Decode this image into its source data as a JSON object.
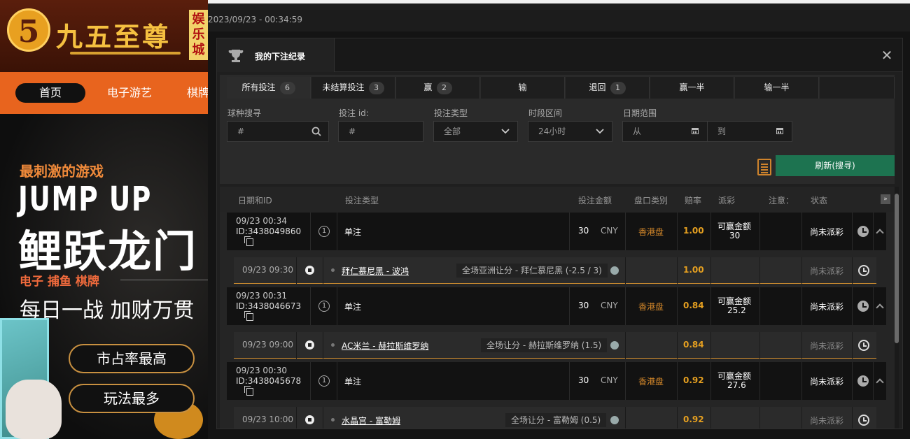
{
  "promo": {
    "logo_char": "5",
    "logo_text": "九五至尊",
    "logo_tag": "娱乐城",
    "nav": [
      "首页",
      "电子游艺",
      "棋牌"
    ],
    "headline": "最刺激的游戏",
    "big_title_1": "JUMP UP",
    "big_title_2": "鲤跃龙门",
    "sub": "电子  捕鱼  棋牌",
    "daily": "每日一战  加财万贯",
    "pill_1": "市占率最高",
    "pill_2": "玩法最多"
  },
  "datebar": {
    "datetime": "2023/09/23 - 00:34:59"
  },
  "modal": {
    "title": "我的下注纪录",
    "close": "✕",
    "tabs": [
      {
        "label": "所有投注",
        "count": "6"
      },
      {
        "label": "未结算投注",
        "count": "3"
      },
      {
        "label": "赢",
        "count": "2"
      },
      {
        "label": "输",
        "count": ""
      },
      {
        "label": "退回",
        "count": "1"
      },
      {
        "label": "赢一半",
        "count": ""
      },
      {
        "label": "输一半",
        "count": ""
      }
    ],
    "filters": {
      "sport_label": "球种搜寻",
      "sport_placeholder": "#",
      "betid_label": "投注 id:",
      "betid_placeholder": "#",
      "bettype_label": "投注类型",
      "bettype_value": "全部",
      "period_label": "时段区间",
      "period_value": "24小时",
      "date_label": "日期范围",
      "date_from": "从",
      "date_to": "到"
    },
    "refresh_label": "刷新(搜寻)",
    "table_headers": {
      "date_id": "日期和ID",
      "bet_type": "投注类型",
      "amount": "投注金额",
      "handicap": "盘口类别",
      "odds": "赔率",
      "payout": "派彩",
      "note": "注意：",
      "status": "状态"
    },
    "bets": [
      {
        "datetime": "09/23 00:34",
        "id": "ID:3438049860",
        "legs": "1",
        "type": "单注",
        "amount": "30",
        "currency": "CNY",
        "handicap": "香港盘",
        "odds": "1.00",
        "payout_label": "可赢金额",
        "payout": "30",
        "status": "尚未派彩",
        "detail": {
          "time": "09/23 09:30",
          "match": "拜仁慕尼黑 - 波鸿",
          "market": "全场亚洲让分 - 拜仁慕尼黑 (-2.5 / 3)",
          "odds": "1.00",
          "status": "尚未派彩"
        }
      },
      {
        "datetime": "09/23 00:31",
        "id": "ID:3438046673",
        "legs": "1",
        "type": "单注",
        "amount": "30",
        "currency": "CNY",
        "handicap": "香港盘",
        "odds": "0.84",
        "payout_label": "可赢金额",
        "payout": "25.2",
        "status": "尚未派彩",
        "detail": {
          "time": "09/23 09:00",
          "match": "AC米兰 - 赫拉斯维罗纳",
          "market": "全场让分 - 赫拉斯维罗纳 (1.5)",
          "odds": "0.84",
          "status": "尚未派彩"
        }
      },
      {
        "datetime": "09/23 00:30",
        "id": "ID:3438045678",
        "legs": "1",
        "type": "单注",
        "amount": "30",
        "currency": "CNY",
        "handicap": "香港盘",
        "odds": "0.92",
        "payout_label": "可赢金额",
        "payout": "27.6",
        "status": "尚未派彩",
        "detail": {
          "time": "09/23 10:00",
          "match": "水晶宫 - 富勒姆",
          "market": "全场让分 - 富勒姆 (0.5)",
          "odds": "0.92",
          "status": "尚未派彩"
        }
      }
    ]
  }
}
